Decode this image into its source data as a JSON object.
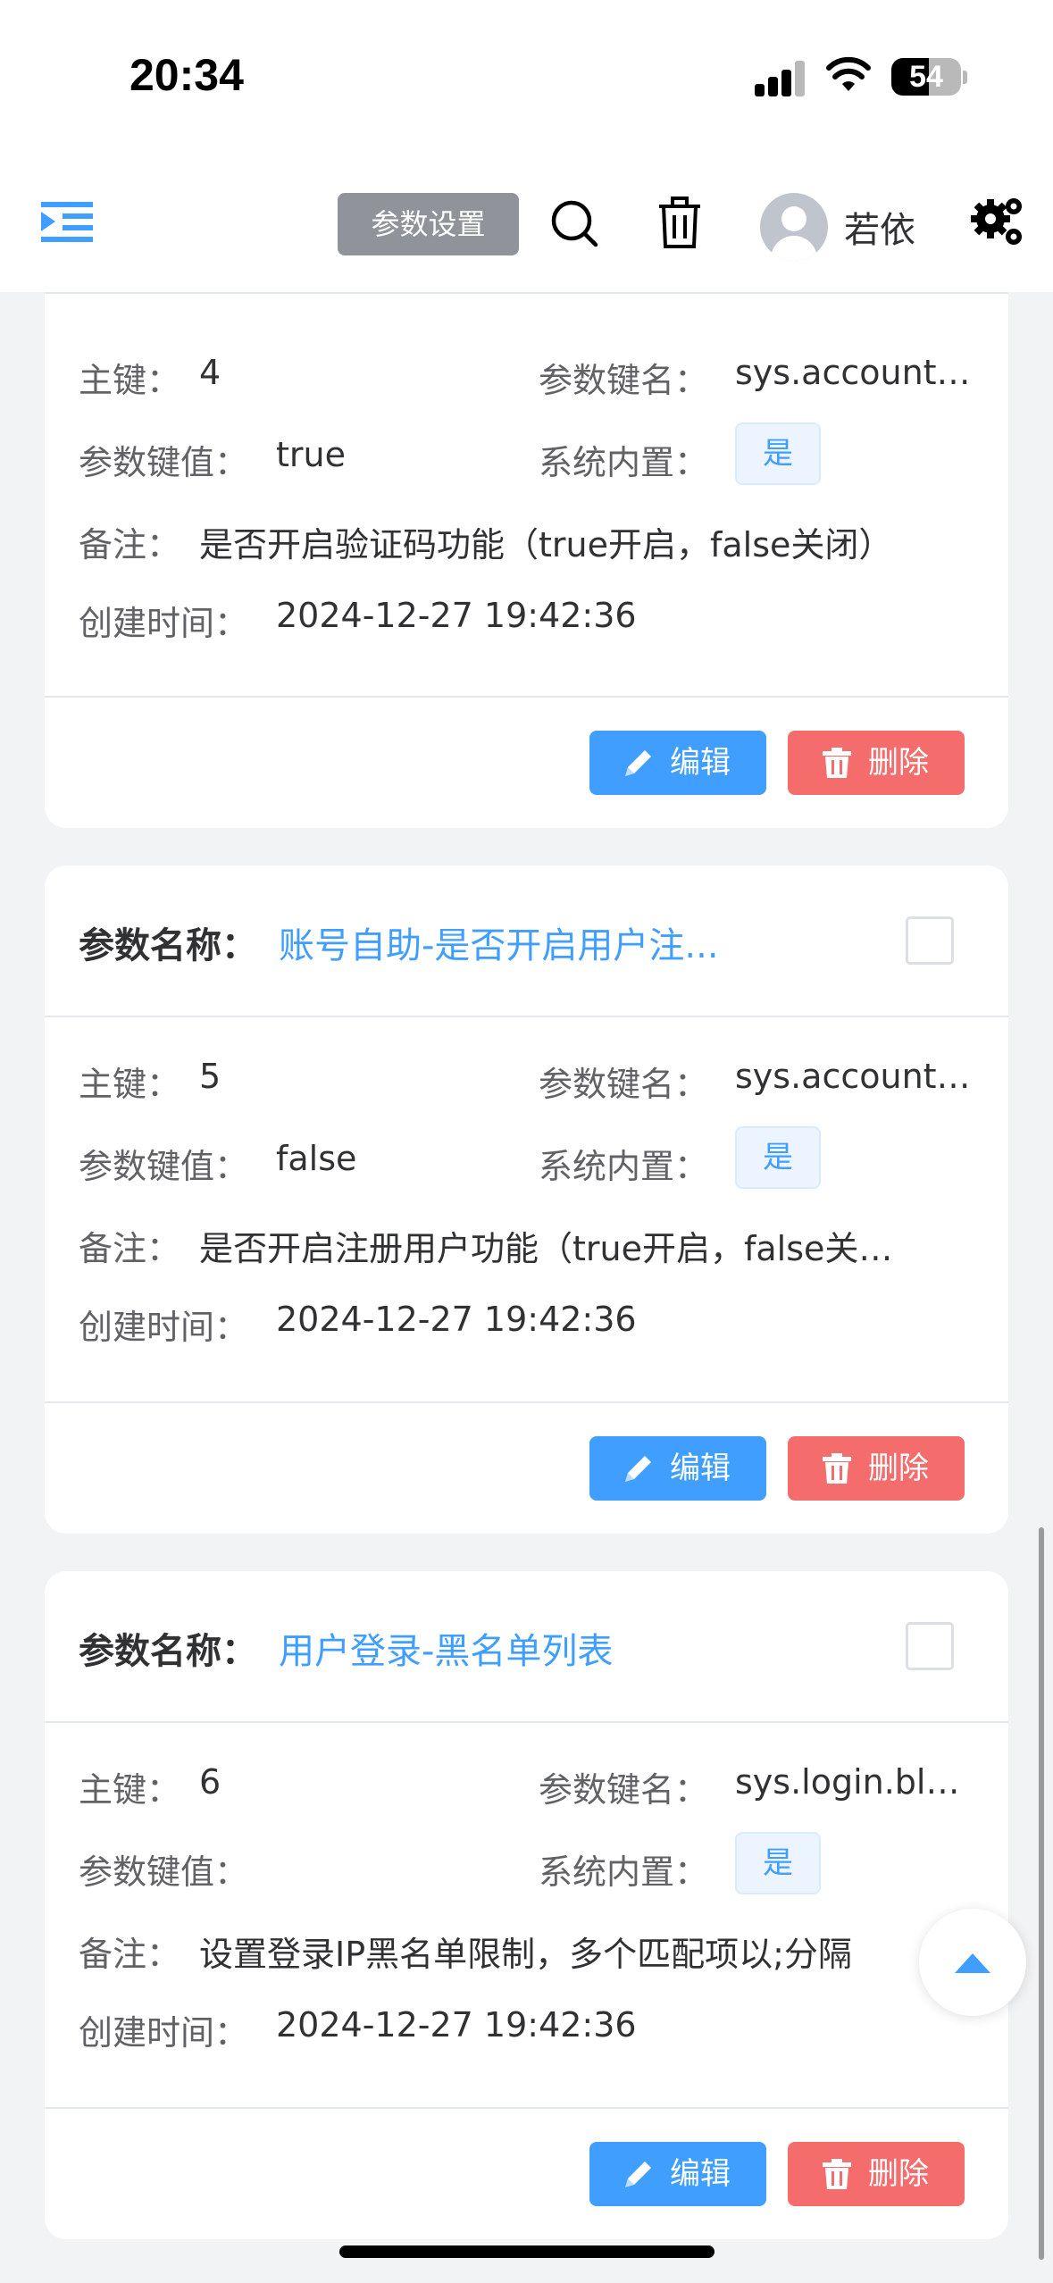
{
  "status_bar": {
    "time": "20:34",
    "battery": "54",
    "battery_level": 0.54
  },
  "navbar": {
    "title": "参数设置",
    "username": "若依",
    "icons": [
      "menu-fold-icon",
      "search-icon",
      "trash-icon",
      "avatar",
      "gear-icon"
    ]
  },
  "labels": {
    "name": "参数名称：",
    "id": "主键：",
    "key": "参数键名：",
    "value": "参数键值：",
    "builtin": "系统内置：",
    "remark": "备注：",
    "created": "创建时间："
  },
  "buttons": {
    "edit": "编辑",
    "delete": "删除"
  },
  "records": [
    {
      "id": "4",
      "key": "sys.account…",
      "value": "true",
      "builtin": "是",
      "remark": "是否开启验证码功能（true开启，false关闭）",
      "created": "2024-12-27 19:42:36"
    },
    {
      "name": "账号自助-是否开启用户注...",
      "id": "5",
      "key": "sys.account…",
      "value": "false",
      "builtin": "是",
      "remark": "是否开启注册用户功能（true开启，false关…",
      "created": "2024-12-27 19:42:36",
      "checked": false
    },
    {
      "name": "用户登录-黑名单列表",
      "id": "6",
      "key": "sys.login.bl…",
      "value": "",
      "builtin": "是",
      "remark": "设置登录IP黑名单限制，多个匹配项以;分隔",
      "created": "2024-12-27 19:42:36",
      "checked": false
    }
  ],
  "colors": {
    "primary": "#409eff",
    "danger": "#f56c6c",
    "title_badge": "#909399"
  }
}
